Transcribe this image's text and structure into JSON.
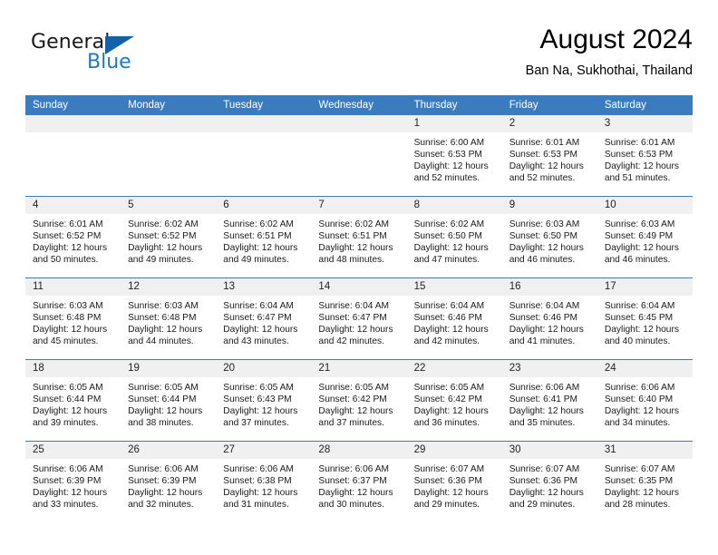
{
  "brand": {
    "name_part1": "General",
    "name_part2": "Blue",
    "logo_icon": "triangle-logo-icon"
  },
  "header": {
    "title": "August 2024",
    "location": "Ban Na, Sukhothai, Thailand"
  },
  "calendar": {
    "weekday_headers": [
      "Sunday",
      "Monday",
      "Tuesday",
      "Wednesday",
      "Thursday",
      "Friday",
      "Saturday"
    ],
    "accent_color": "#3a7cbe",
    "daynum_background": "#f0f0f0",
    "weeks": [
      [
        {
          "day": "",
          "empty": true
        },
        {
          "day": "",
          "empty": true
        },
        {
          "day": "",
          "empty": true
        },
        {
          "day": "",
          "empty": true
        },
        {
          "day": "1",
          "sunrise": "Sunrise: 6:00 AM",
          "sunset": "Sunset: 6:53 PM",
          "daylight_line1": "Daylight: 12 hours",
          "daylight_line2": "and 52 minutes."
        },
        {
          "day": "2",
          "sunrise": "Sunrise: 6:01 AM",
          "sunset": "Sunset: 6:53 PM",
          "daylight_line1": "Daylight: 12 hours",
          "daylight_line2": "and 52 minutes."
        },
        {
          "day": "3",
          "sunrise": "Sunrise: 6:01 AM",
          "sunset": "Sunset: 6:53 PM",
          "daylight_line1": "Daylight: 12 hours",
          "daylight_line2": "and 51 minutes."
        }
      ],
      [
        {
          "day": "4",
          "sunrise": "Sunrise: 6:01 AM",
          "sunset": "Sunset: 6:52 PM",
          "daylight_line1": "Daylight: 12 hours",
          "daylight_line2": "and 50 minutes."
        },
        {
          "day": "5",
          "sunrise": "Sunrise: 6:02 AM",
          "sunset": "Sunset: 6:52 PM",
          "daylight_line1": "Daylight: 12 hours",
          "daylight_line2": "and 49 minutes."
        },
        {
          "day": "6",
          "sunrise": "Sunrise: 6:02 AM",
          "sunset": "Sunset: 6:51 PM",
          "daylight_line1": "Daylight: 12 hours",
          "daylight_line2": "and 49 minutes."
        },
        {
          "day": "7",
          "sunrise": "Sunrise: 6:02 AM",
          "sunset": "Sunset: 6:51 PM",
          "daylight_line1": "Daylight: 12 hours",
          "daylight_line2": "and 48 minutes."
        },
        {
          "day": "8",
          "sunrise": "Sunrise: 6:02 AM",
          "sunset": "Sunset: 6:50 PM",
          "daylight_line1": "Daylight: 12 hours",
          "daylight_line2": "and 47 minutes."
        },
        {
          "day": "9",
          "sunrise": "Sunrise: 6:03 AM",
          "sunset": "Sunset: 6:50 PM",
          "daylight_line1": "Daylight: 12 hours",
          "daylight_line2": "and 46 minutes."
        },
        {
          "day": "10",
          "sunrise": "Sunrise: 6:03 AM",
          "sunset": "Sunset: 6:49 PM",
          "daylight_line1": "Daylight: 12 hours",
          "daylight_line2": "and 46 minutes."
        }
      ],
      [
        {
          "day": "11",
          "sunrise": "Sunrise: 6:03 AM",
          "sunset": "Sunset: 6:48 PM",
          "daylight_line1": "Daylight: 12 hours",
          "daylight_line2": "and 45 minutes."
        },
        {
          "day": "12",
          "sunrise": "Sunrise: 6:03 AM",
          "sunset": "Sunset: 6:48 PM",
          "daylight_line1": "Daylight: 12 hours",
          "daylight_line2": "and 44 minutes."
        },
        {
          "day": "13",
          "sunrise": "Sunrise: 6:04 AM",
          "sunset": "Sunset: 6:47 PM",
          "daylight_line1": "Daylight: 12 hours",
          "daylight_line2": "and 43 minutes."
        },
        {
          "day": "14",
          "sunrise": "Sunrise: 6:04 AM",
          "sunset": "Sunset: 6:47 PM",
          "daylight_line1": "Daylight: 12 hours",
          "daylight_line2": "and 42 minutes."
        },
        {
          "day": "15",
          "sunrise": "Sunrise: 6:04 AM",
          "sunset": "Sunset: 6:46 PM",
          "daylight_line1": "Daylight: 12 hours",
          "daylight_line2": "and 42 minutes."
        },
        {
          "day": "16",
          "sunrise": "Sunrise: 6:04 AM",
          "sunset": "Sunset: 6:46 PM",
          "daylight_line1": "Daylight: 12 hours",
          "daylight_line2": "and 41 minutes."
        },
        {
          "day": "17",
          "sunrise": "Sunrise: 6:04 AM",
          "sunset": "Sunset: 6:45 PM",
          "daylight_line1": "Daylight: 12 hours",
          "daylight_line2": "and 40 minutes."
        }
      ],
      [
        {
          "day": "18",
          "sunrise": "Sunrise: 6:05 AM",
          "sunset": "Sunset: 6:44 PM",
          "daylight_line1": "Daylight: 12 hours",
          "daylight_line2": "and 39 minutes."
        },
        {
          "day": "19",
          "sunrise": "Sunrise: 6:05 AM",
          "sunset": "Sunset: 6:44 PM",
          "daylight_line1": "Daylight: 12 hours",
          "daylight_line2": "and 38 minutes."
        },
        {
          "day": "20",
          "sunrise": "Sunrise: 6:05 AM",
          "sunset": "Sunset: 6:43 PM",
          "daylight_line1": "Daylight: 12 hours",
          "daylight_line2": "and 37 minutes."
        },
        {
          "day": "21",
          "sunrise": "Sunrise: 6:05 AM",
          "sunset": "Sunset: 6:42 PM",
          "daylight_line1": "Daylight: 12 hours",
          "daylight_line2": "and 37 minutes."
        },
        {
          "day": "22",
          "sunrise": "Sunrise: 6:05 AM",
          "sunset": "Sunset: 6:42 PM",
          "daylight_line1": "Daylight: 12 hours",
          "daylight_line2": "and 36 minutes."
        },
        {
          "day": "23",
          "sunrise": "Sunrise: 6:06 AM",
          "sunset": "Sunset: 6:41 PM",
          "daylight_line1": "Daylight: 12 hours",
          "daylight_line2": "and 35 minutes."
        },
        {
          "day": "24",
          "sunrise": "Sunrise: 6:06 AM",
          "sunset": "Sunset: 6:40 PM",
          "daylight_line1": "Daylight: 12 hours",
          "daylight_line2": "and 34 minutes."
        }
      ],
      [
        {
          "day": "25",
          "sunrise": "Sunrise: 6:06 AM",
          "sunset": "Sunset: 6:39 PM",
          "daylight_line1": "Daylight: 12 hours",
          "daylight_line2": "and 33 minutes."
        },
        {
          "day": "26",
          "sunrise": "Sunrise: 6:06 AM",
          "sunset": "Sunset: 6:39 PM",
          "daylight_line1": "Daylight: 12 hours",
          "daylight_line2": "and 32 minutes."
        },
        {
          "day": "27",
          "sunrise": "Sunrise: 6:06 AM",
          "sunset": "Sunset: 6:38 PM",
          "daylight_line1": "Daylight: 12 hours",
          "daylight_line2": "and 31 minutes."
        },
        {
          "day": "28",
          "sunrise": "Sunrise: 6:06 AM",
          "sunset": "Sunset: 6:37 PM",
          "daylight_line1": "Daylight: 12 hours",
          "daylight_line2": "and 30 minutes."
        },
        {
          "day": "29",
          "sunrise": "Sunrise: 6:07 AM",
          "sunset": "Sunset: 6:36 PM",
          "daylight_line1": "Daylight: 12 hours",
          "daylight_line2": "and 29 minutes."
        },
        {
          "day": "30",
          "sunrise": "Sunrise: 6:07 AM",
          "sunset": "Sunset: 6:36 PM",
          "daylight_line1": "Daylight: 12 hours",
          "daylight_line2": "and 29 minutes."
        },
        {
          "day": "31",
          "sunrise": "Sunrise: 6:07 AM",
          "sunset": "Sunset: 6:35 PM",
          "daylight_line1": "Daylight: 12 hours",
          "daylight_line2": "and 28 minutes."
        }
      ]
    ]
  }
}
